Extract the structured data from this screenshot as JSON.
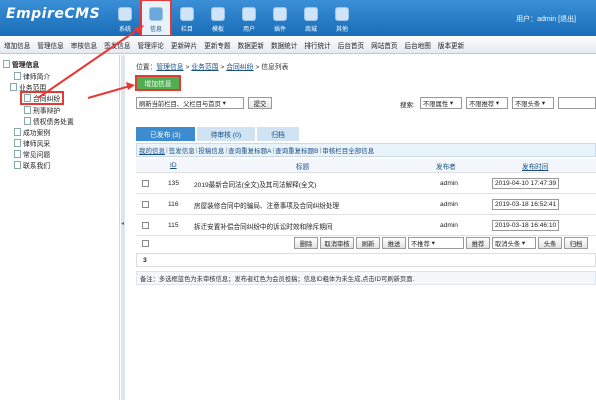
{
  "header": {
    "logo": "EmpireCMS",
    "nav": [
      {
        "label": "系统",
        "icon": "system-icon"
      },
      {
        "label": "信息",
        "icon": "info-icon",
        "active": true
      },
      {
        "label": "栏目",
        "icon": "column-icon"
      },
      {
        "label": "模板",
        "icon": "template-icon"
      },
      {
        "label": "用户",
        "icon": "user-icon"
      },
      {
        "label": "插件",
        "icon": "plugin-icon"
      },
      {
        "label": "商城",
        "icon": "shop-icon"
      },
      {
        "label": "其他",
        "icon": "other-icon"
      }
    ],
    "user_text": "用户：admin [退出]"
  },
  "menubar": [
    "增加信息",
    "管理信息",
    "审核信息",
    "签发信息",
    "管理评论",
    "更新碎片",
    "更新专题",
    "数据更新",
    "数据统计",
    "排行统计",
    "后台首页",
    "网站首页",
    "后台地图",
    "版本更新"
  ],
  "sidebar": {
    "root": "管理信息",
    "items": [
      {
        "label": "律师简介",
        "level": 1
      },
      {
        "label": "业务范围",
        "level": 1
      },
      {
        "label": "合同纠纷",
        "level": 2,
        "selected": true
      },
      {
        "label": "刑事辩护",
        "level": 2
      },
      {
        "label": "债权债务处置",
        "level": 2
      },
      {
        "label": "成功案例",
        "level": 1
      },
      {
        "label": "律师风采",
        "level": 1
      },
      {
        "label": "常见问题",
        "level": 1
      },
      {
        "label": "联系我们",
        "level": 1
      }
    ],
    "collapse_arrow": "◂"
  },
  "main": {
    "breadcrumb_prefix": "位置：",
    "breadcrumb": [
      "管理信息",
      "业务范围",
      "合同纠纷",
      "信息列表"
    ],
    "add_button": "增加信息",
    "refresh_select": "刷新当前栏目、父栏目与首页",
    "submit": "提交",
    "search_label": "搜索:",
    "filter1": "不限属性",
    "filter2": "不限推荐",
    "filter3": "不限头条",
    "tabs": [
      "已发布 (3)",
      "待审核 (0)",
      "归档"
    ],
    "subtabs": [
      "我的信息",
      "签发信息",
      "投稿信息",
      "查询重复标题A",
      "查询重复标题B",
      "审核栏目全部信息"
    ],
    "table_headers": {
      "id": "ID",
      "title": "标题",
      "publisher": "发布者",
      "time": "发布时间"
    },
    "rows": [
      {
        "id": "135",
        "title": "2019最新合同法(全文)及其司法解释(全文)",
        "publisher": "admin",
        "time": "2019-04-10 17:47:39"
      },
      {
        "id": "116",
        "title": "房屋装修合同中的骗局、注意事项及合同纠纷处理",
        "publisher": "admin",
        "time": "2019-03-18 16:52:41"
      },
      {
        "id": "115",
        "title": "拆迁安置补偿合同纠纷中的诉讼时效和除斥期间",
        "publisher": "admin",
        "time": "2019-03-18 16:46:10"
      }
    ],
    "actions": [
      "删除",
      "取消审核",
      "刷新",
      "推送",
      "不推荐",
      "推荐",
      "取消头条",
      "头条",
      "归档"
    ],
    "page_number": "3",
    "note": "备注：多选框蓝色为未审核信息；发布者红色为会员投稿；信息ID粗体为未生成,点击ID可刷新页面."
  }
}
